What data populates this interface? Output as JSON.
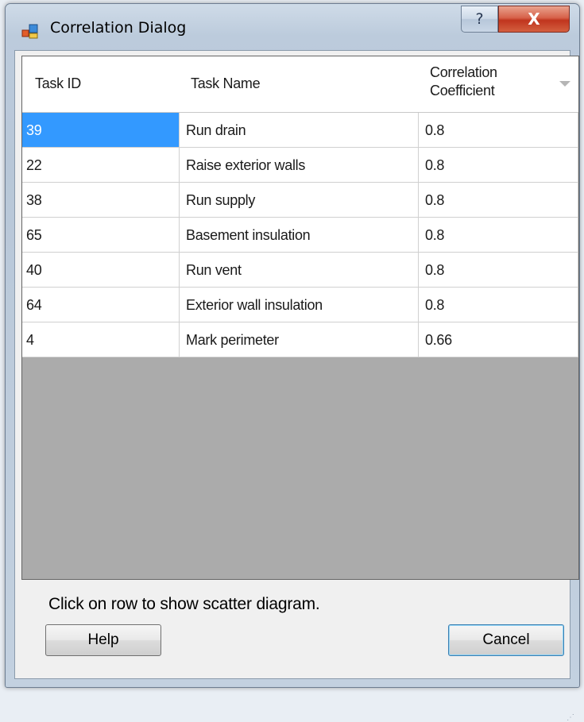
{
  "window": {
    "title": "Correlation Dialog",
    "help_glyph": "?",
    "close_glyph": "X",
    "icon": "app-window-icon"
  },
  "grid": {
    "columns": [
      "Task ID",
      "Task Name",
      "Correlation Coefficient"
    ],
    "rows": [
      {
        "id": "39",
        "name": "Run drain",
        "coef": "0.8",
        "selected": true
      },
      {
        "id": "22",
        "name": "Raise exterior walls",
        "coef": "0.8"
      },
      {
        "id": "38",
        "name": "Run supply",
        "coef": "0.8"
      },
      {
        "id": "65",
        "name": "Basement insulation",
        "coef": "0.8"
      },
      {
        "id": "40",
        "name": "Run vent",
        "coef": "0.8"
      },
      {
        "id": "64",
        "name": "Exterior wall insulation",
        "coef": "0.8"
      },
      {
        "id": "4",
        "name": "Mark perimeter",
        "coef": "0.66"
      }
    ],
    "sort_icon": "sort-descending-icon"
  },
  "footer": {
    "hint": "Click on row to show scatter diagram.",
    "help_label": "Help",
    "cancel_label": "Cancel"
  },
  "colors": {
    "selection": "#3399ff",
    "grid_background": "#aaaaaa",
    "close_button": "#c0351e"
  }
}
